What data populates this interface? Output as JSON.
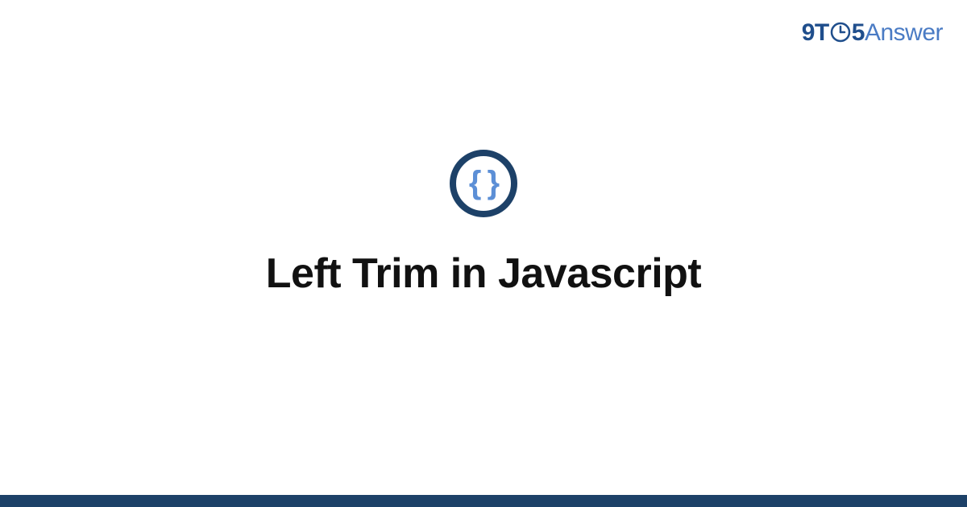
{
  "brand": {
    "part1": "9T",
    "part2": "5",
    "part3": "Answer"
  },
  "icon": {
    "semantic": "code-braces-icon",
    "glyph": "{ }"
  },
  "title": "Left Trim in Javascript",
  "colors": {
    "brand_dark": "#1f4e8c",
    "brand_light": "#4a7bc4",
    "icon_ring": "#1d4168",
    "icon_brace": "#5c8fd6",
    "footer": "#1d4168",
    "title_text": "#111111"
  }
}
